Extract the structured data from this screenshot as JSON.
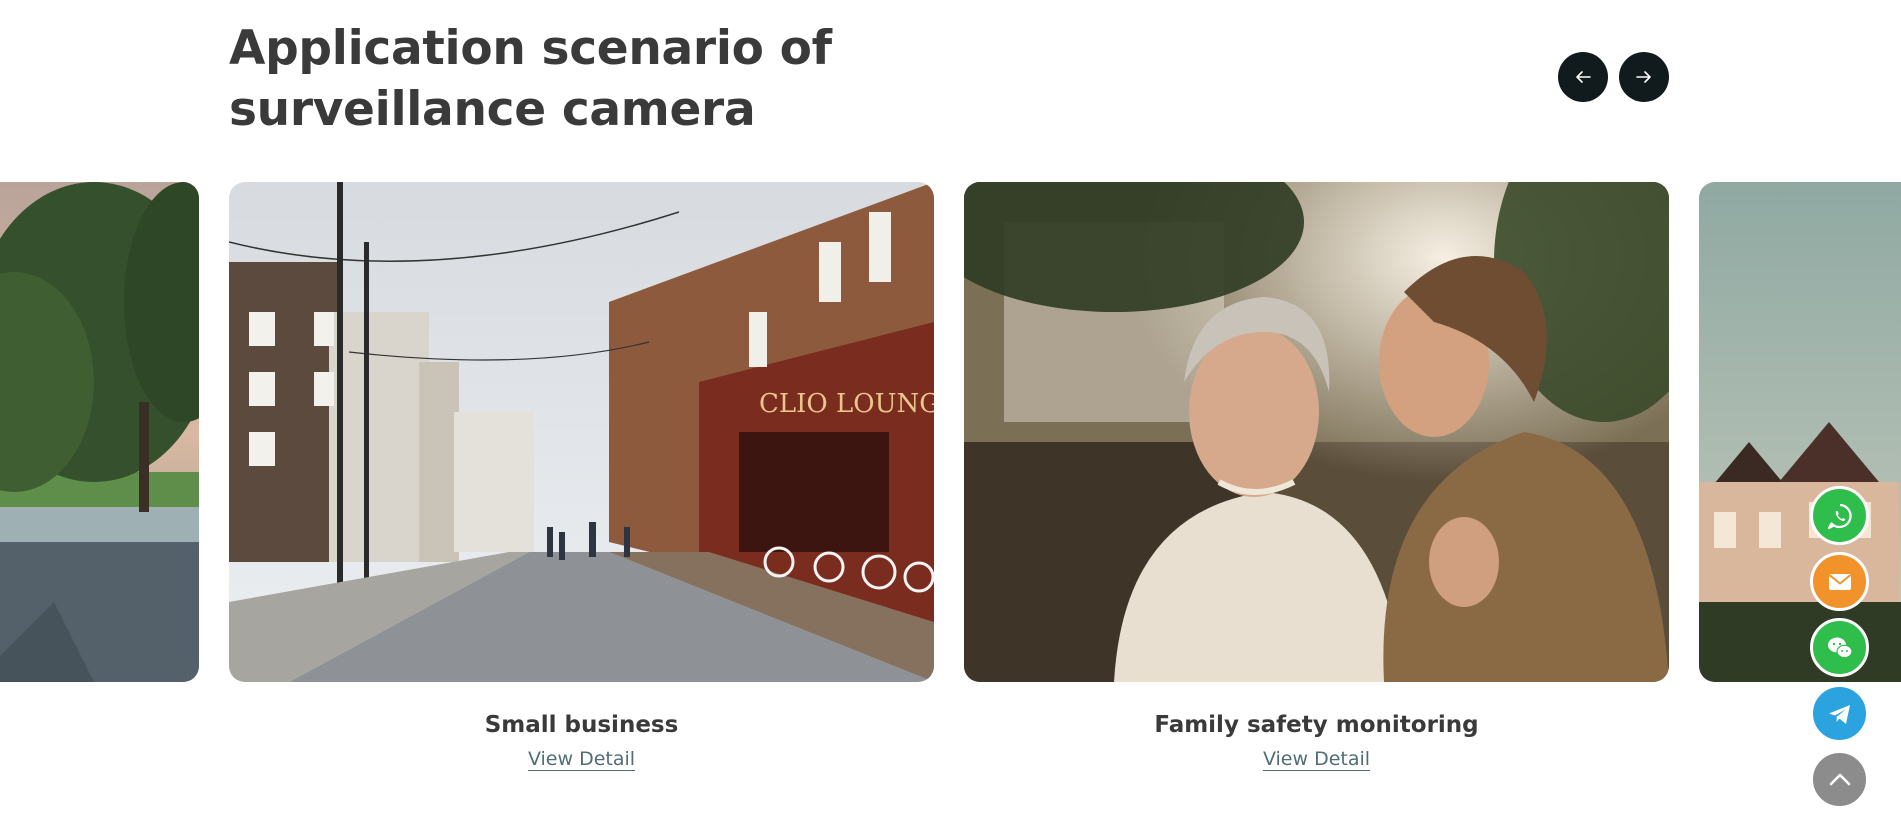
{
  "section": {
    "title": "Application scenario of surveillance camera"
  },
  "carousel": {
    "prev_icon": "arrow-left-icon",
    "next_icon": "arrow-right-icon",
    "cards": [
      {
        "title": "Small business",
        "link": "View Detail",
        "image": "city-street-shopfronts"
      },
      {
        "title": "Family safety monitoring",
        "link": "View Detail",
        "image": "elderly-woman-and-caregiver"
      }
    ],
    "partial_cards": [
      "lakeside-trees",
      "victorian-houses"
    ]
  },
  "floating_contacts": [
    {
      "name": "whatsapp",
      "icon": "whatsapp-icon",
      "color": "#2fbe4b"
    },
    {
      "name": "email",
      "icon": "email-icon",
      "color": "#f2922b"
    },
    {
      "name": "wechat",
      "icon": "wechat-icon",
      "color": "#2fbe4b"
    },
    {
      "name": "telegram",
      "icon": "telegram-icon",
      "color": "#2aa3df"
    },
    {
      "name": "back-to-top",
      "icon": "chevron-up-icon",
      "color": "#8c8c8c"
    }
  ],
  "colors": {
    "title": "#3a3a3a",
    "nav_button": "#111a1c",
    "link": "#506d75"
  }
}
